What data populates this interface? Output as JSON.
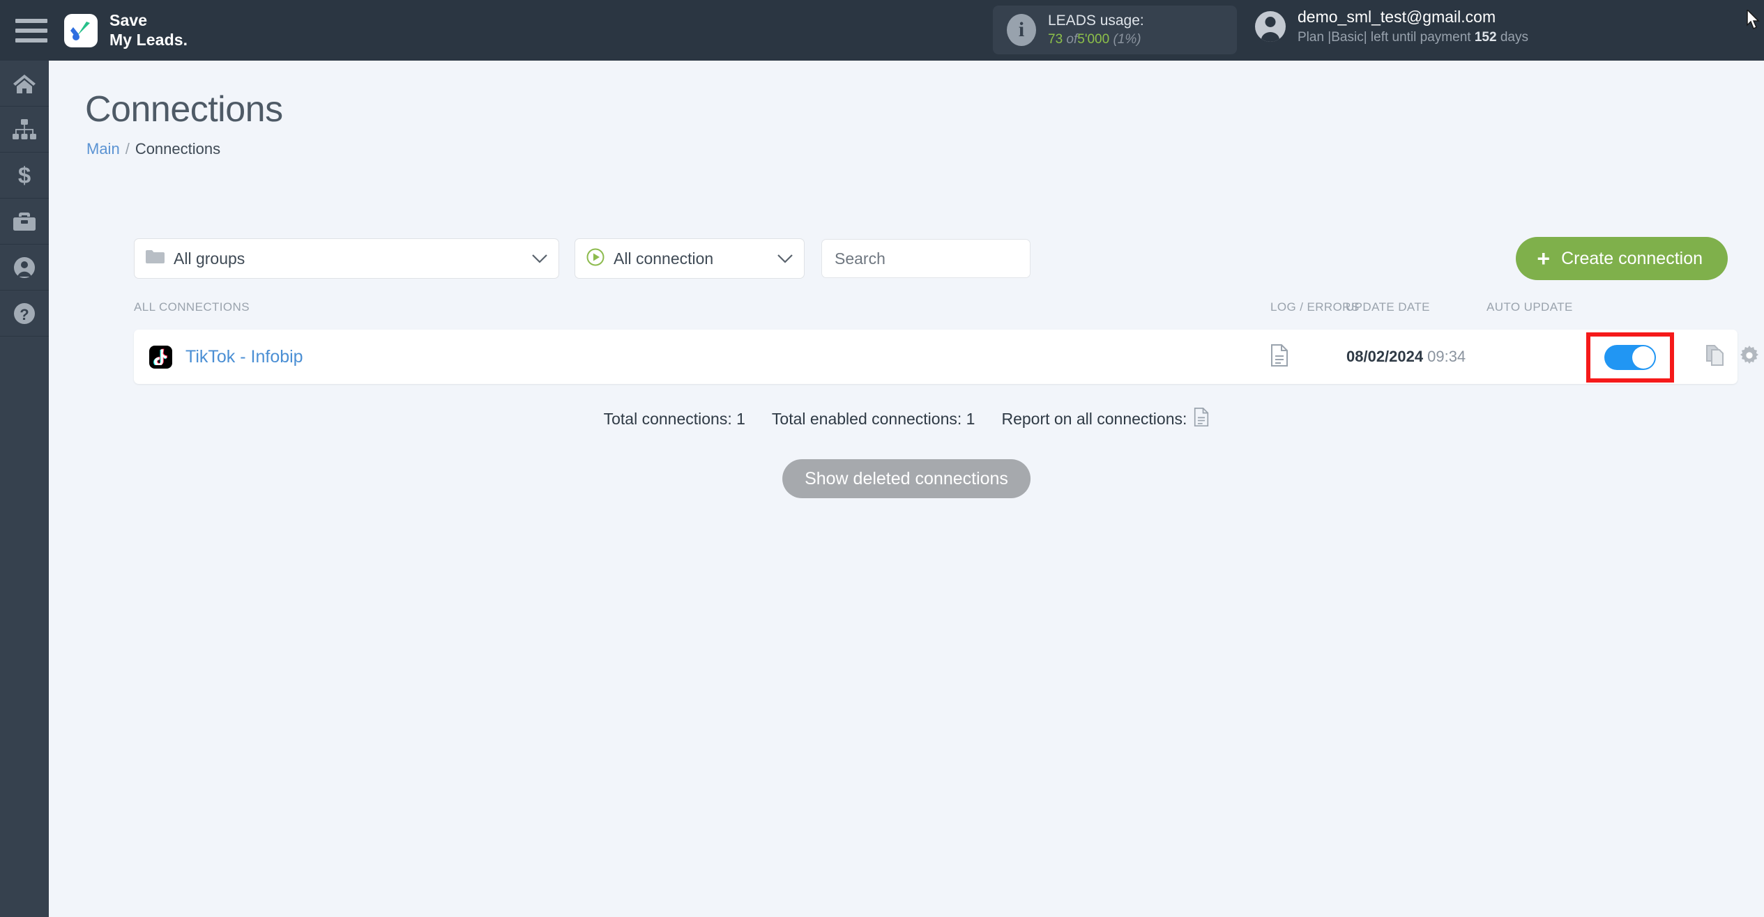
{
  "header": {
    "menu_icon": "hamburger-icon",
    "brand_line1": "Save",
    "brand_line2": "My Leads.",
    "leads": {
      "info_icon": "info-icon",
      "title": "LEADS usage:",
      "used": "73",
      "of": "of",
      "total": "5'000",
      "percent": "(1%)"
    },
    "account": {
      "avatar_icon": "user-avatar-icon",
      "email": "demo_sml_test@gmail.com",
      "plan_prefix": "Plan |Basic| left until payment",
      "days_value": "152",
      "days_suffix": "days"
    }
  },
  "sidebar": {
    "items": [
      {
        "icon": "home-icon",
        "name": "sidebar-item-home"
      },
      {
        "icon": "sitemap-icon",
        "name": "sidebar-item-connections"
      },
      {
        "icon": "dollar-icon",
        "name": "sidebar-item-billing"
      },
      {
        "icon": "briefcase-icon",
        "name": "sidebar-item-business"
      },
      {
        "icon": "user-icon",
        "name": "sidebar-item-profile"
      },
      {
        "icon": "question-icon",
        "name": "sidebar-item-help"
      }
    ]
  },
  "page": {
    "title": "Connections",
    "breadcrumb_root": "Main",
    "breadcrumb_sep": "/",
    "breadcrumb_current": "Connections"
  },
  "filters": {
    "groups_icon": "folder-icon",
    "groups_value": "All groups",
    "connection_icon": "play-circle-icon",
    "connection_value": "All connection",
    "search_placeholder": "Search",
    "search_value": "",
    "create_label": "Create connection",
    "create_plus": "+"
  },
  "table": {
    "columns": {
      "name": "ALL CONNECTIONS",
      "log": "LOG / ERRORS",
      "date": "UPDATE DATE",
      "auto": "AUTO UPDATE"
    },
    "rows": [
      {
        "service_icon": "tiktok-icon",
        "name": "TikTok - Infobip",
        "log_icon": "document-icon",
        "date": "08/02/2024",
        "time": "09:34",
        "auto_update_on": true,
        "actions": [
          "copy-icon",
          "gear-icon",
          "trash-icon"
        ]
      }
    ]
  },
  "totals": {
    "total_connections": "Total connections: 1",
    "total_enabled": "Total enabled connections: 1",
    "report_label": "Report on all connections:",
    "report_icon": "document-icon"
  },
  "footer": {
    "show_deleted_label": "Show deleted connections"
  },
  "colors": {
    "header_bg": "#2b3642",
    "sidebar_bg": "#36414e",
    "page_bg": "#f2f5fa",
    "accent_green": "#7fb04b",
    "link_blue": "#4b8fd4",
    "toggle_on": "#2196f3",
    "highlight_red": "#f51a1a",
    "muted_gray": "#a6a9ad"
  }
}
